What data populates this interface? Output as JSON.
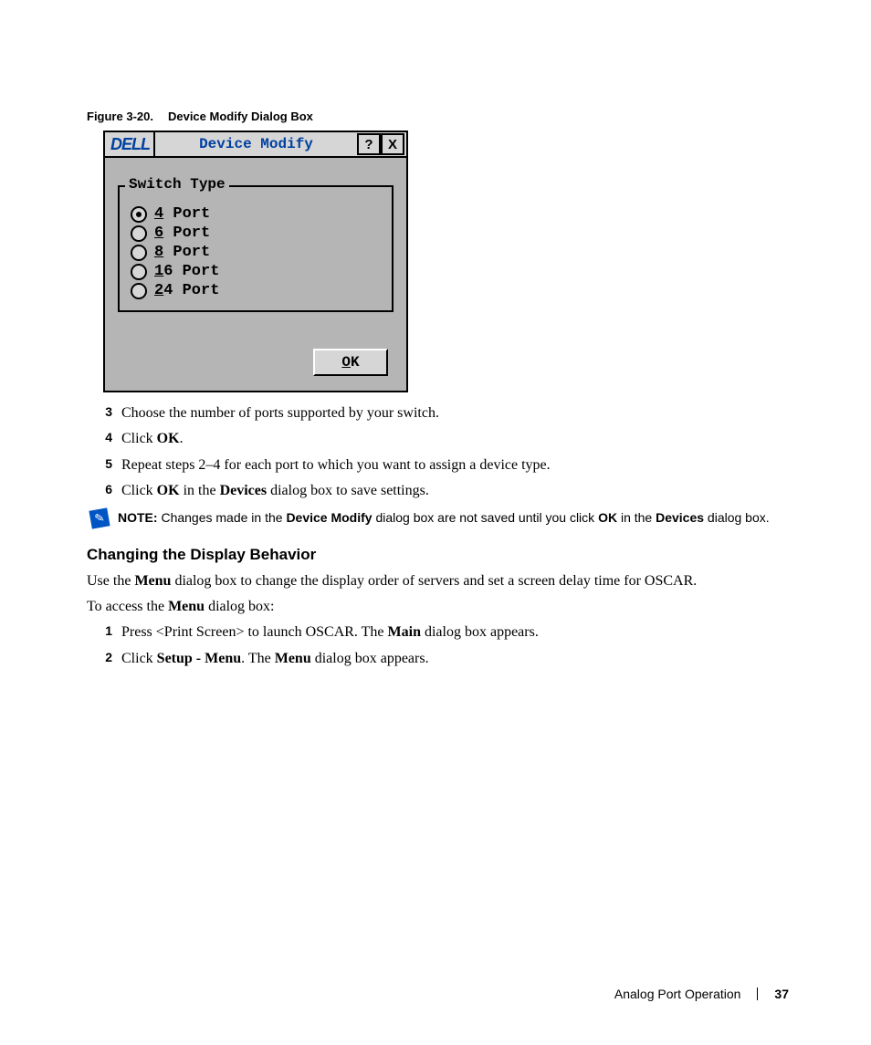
{
  "figure": {
    "number": "Figure 3-20.",
    "title": "Device Modify Dialog Box"
  },
  "dialog": {
    "logo": "DELL",
    "title": "Device Modify",
    "help_btn": "?",
    "close_btn": "X",
    "group_label": "Switch Type",
    "options": [
      {
        "key": "4",
        "rest": " Port",
        "selected": true
      },
      {
        "key": "6",
        "rest": " Port",
        "selected": false
      },
      {
        "key": "8",
        "rest": " Port",
        "selected": false
      },
      {
        "key": "1",
        "rest": "6 Port",
        "selected": false
      },
      {
        "key": "2",
        "rest": "4 Port",
        "selected": false
      }
    ],
    "ok_key": "O",
    "ok_rest": "K"
  },
  "steps1": [
    {
      "num": "3",
      "pre": "Choose the number of ports supported by your switch.",
      "bold1": "",
      "mid": "",
      "bold2": "",
      "post": ""
    },
    {
      "num": "4",
      "pre": "Click ",
      "bold1": "OK",
      "mid": ".",
      "bold2": "",
      "post": ""
    },
    {
      "num": "5",
      "pre": "Repeat steps 2–4 for each port to which you want to assign a device type.",
      "bold1": "",
      "mid": "",
      "bold2": "",
      "post": ""
    },
    {
      "num": "6",
      "pre": "Click ",
      "bold1": "OK",
      "mid": " in the ",
      "bold2": "Devices",
      "post": " dialog box to save settings."
    }
  ],
  "note": {
    "label": "NOTE:",
    "p1": " Changes made in the ",
    "b1": "Device Modify",
    "p2": " dialog box are not saved until you click ",
    "b2": "OK",
    "p3": " in the ",
    "b3": "Devices",
    "p4": " dialog box."
  },
  "heading": "Changing the Display Behavior",
  "para1": {
    "p1": "Use the ",
    "b1": "Menu",
    "p2": " dialog box to change the display order of servers and set a screen delay time for OSCAR."
  },
  "para2": {
    "p1": "To access the ",
    "b1": "Menu",
    "p2": " dialog box:"
  },
  "steps2": [
    {
      "num": "1",
      "pre": "Press <Print Screen> to launch OSCAR. The ",
      "bold1": "Main",
      "mid": " dialog box appears.",
      "bold2": "",
      "post": ""
    },
    {
      "num": "2",
      "pre": "Click ",
      "bold1": "Setup - Menu",
      "mid": ". The ",
      "bold2": "Menu",
      "post": " dialog box appears."
    }
  ],
  "footer": {
    "section": "Analog Port Operation",
    "page": "37"
  }
}
